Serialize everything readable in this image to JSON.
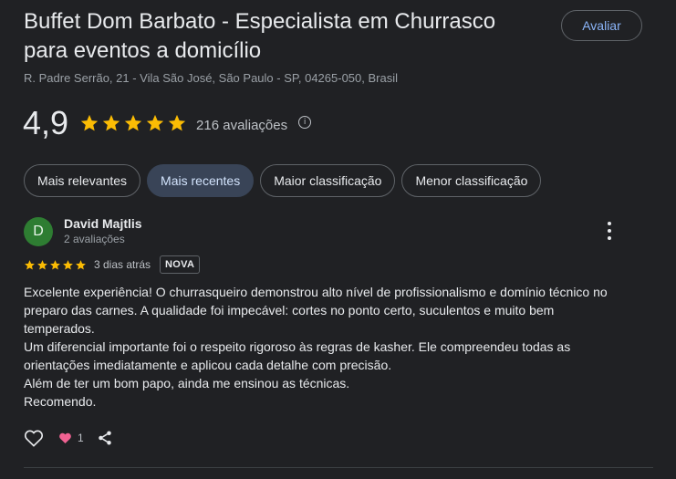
{
  "business": {
    "title": "Buffet Dom Barbato - Especialista em Churrasco para eventos a domicílio",
    "address": "R. Padre Serrão, 21 - Vila São José, São Paulo - SP, 04265-050, Brasil",
    "rate_button": "Avaliar"
  },
  "summary": {
    "average": "4,9",
    "stars": 5,
    "count_label": "216 avaliações",
    "info_icon": "info-icon"
  },
  "sort_chips": [
    {
      "label": "Mais relevantes",
      "active": false
    },
    {
      "label": "Mais recentes",
      "active": true
    },
    {
      "label": "Maior classificação",
      "active": false
    },
    {
      "label": "Menor classificação",
      "active": false
    }
  ],
  "review": {
    "avatar_letter": "D",
    "name": "David Majtlis",
    "reviews_count": "2 avaliações",
    "stars": 5,
    "date": "3 dias atrás",
    "badge": "NOVA",
    "text_lines": [
      "Excelente experiência! O churrasqueiro demonstrou alto nível de profissionalismo e domínio técnico no preparo das carnes. A qualidade foi impecável: cortes no ponto certo, suculentos e muito bem temperados.",
      "Um diferencial importante foi o respeito rigoroso às regras de kasher. Ele compreendeu todas as orientações imediatamente e aplicou cada detalhe com precisão.",
      "Além de ter um bom papo, ainda me ensinou as técnicas.",
      "Recomendo."
    ],
    "likes": "1"
  },
  "colors": {
    "background": "#202124",
    "star": "#fbbc04",
    "accent": "#8ab4f8",
    "active_chip": "#394457",
    "avatar": "#2e7d32",
    "heart": "#f06292"
  }
}
